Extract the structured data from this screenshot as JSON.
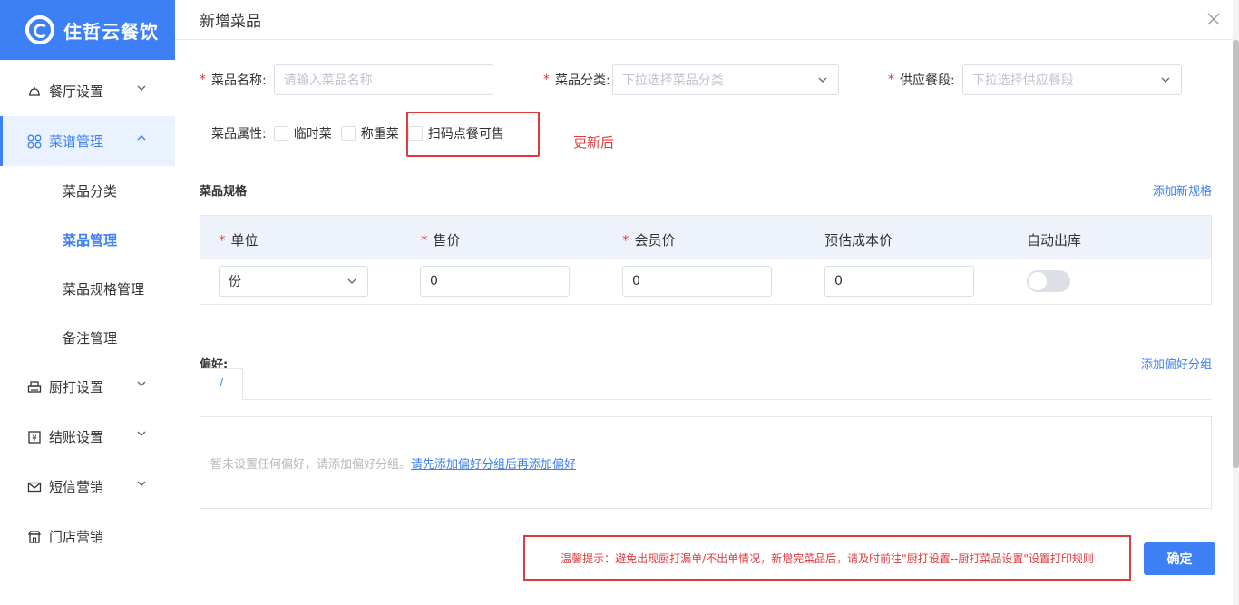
{
  "brand": {
    "name": "住哲云餐饮"
  },
  "sidebar": {
    "items": [
      {
        "label": "餐厅设置",
        "icon": "restaurant-icon"
      },
      {
        "label": "菜谱管理",
        "icon": "menu-grid-icon",
        "active": true
      },
      {
        "label": "厨打设置",
        "icon": "printer-icon"
      },
      {
        "label": "结账设置",
        "icon": "checkout-icon"
      },
      {
        "label": "短信营销",
        "icon": "mail-icon"
      },
      {
        "label": "门店营销",
        "icon": "store-icon"
      }
    ],
    "sub_items": [
      "菜品分类",
      "菜品管理",
      "菜品规格管理",
      "备注管理"
    ],
    "current_sub": "菜品管理"
  },
  "dialog": {
    "title": "新增菜品",
    "fields": {
      "name_label": "菜品名称:",
      "name_placeholder": "请输入菜品名称",
      "category_label": "菜品分类:",
      "category_placeholder": "下拉选择菜品分类",
      "period_label": "供应餐段:",
      "period_placeholder": "下拉选择供应餐段"
    },
    "attributes": {
      "label": "菜品属性:",
      "options": [
        "临时菜",
        "称重菜",
        "扫码点餐可售"
      ]
    },
    "annotation": "更新后",
    "spec": {
      "title": "菜品规格",
      "add_link": "添加新规格",
      "headers": [
        "单位",
        "售价",
        "会员价",
        "预估成本价",
        "自动出库"
      ],
      "unit_value": "份",
      "price_value": "0",
      "member_price_value": "0",
      "cost_value": "0",
      "auto_out": false
    },
    "preference": {
      "title": "偏好:",
      "add_link": "添加偏好分组",
      "tab_label": "/",
      "empty_text": "暂未设置任何偏好，请添加偏好分组。",
      "empty_link": "请先添加偏好分组后再添加偏好"
    },
    "tip": "温馨提示：避免出现厨打漏单/不出单情况，新增完菜品后，请及时前往\"厨打设置--厨打菜品设置\"设置打印规则",
    "confirm_label": "确定"
  },
  "colors": {
    "accent": "#3d7ff5",
    "warning": "#e4393c"
  }
}
